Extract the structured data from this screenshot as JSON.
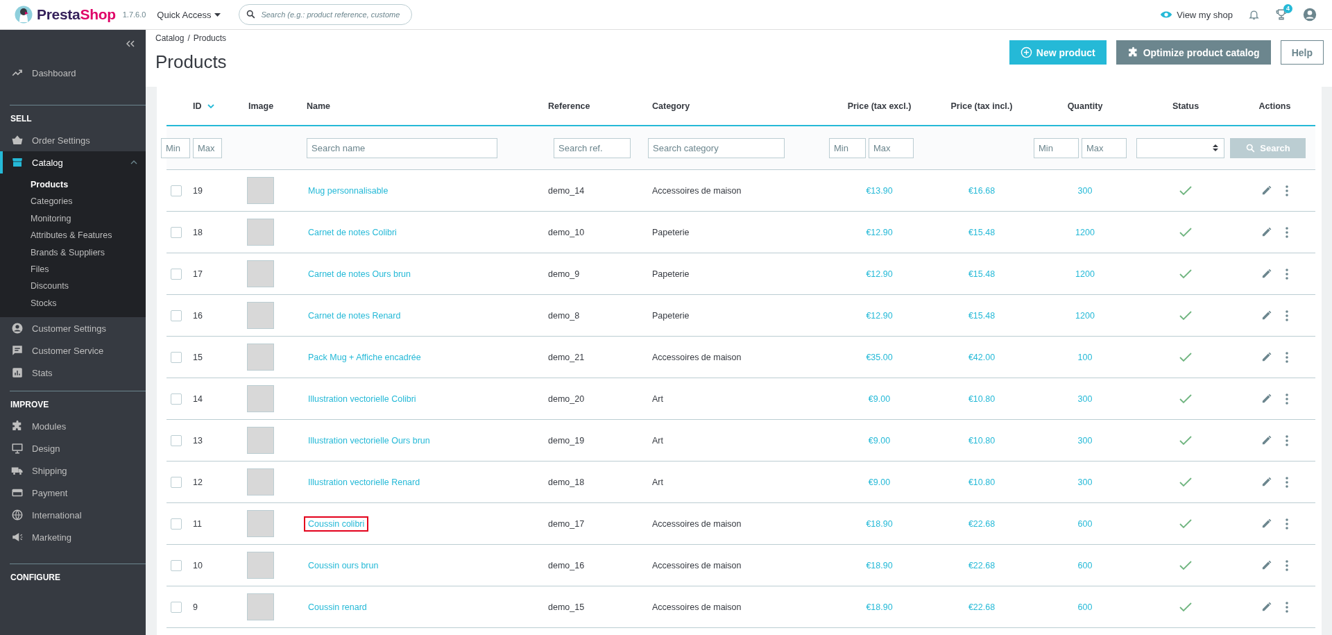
{
  "header": {
    "logo": {
      "first": "Presta",
      "second": "Shop"
    },
    "version": "1.7.6.0",
    "quick_access": "Quick Access",
    "search": {
      "placeholder": "Search (e.g.: product reference, custome"
    },
    "view_shop": "View my shop",
    "trophy_badge": "4"
  },
  "sidebar": {
    "sections": [
      {
        "items": [
          {
            "label": "Dashboard",
            "selected": false
          }
        ]
      },
      {
        "title": "SELL",
        "items": [
          {
            "label": "Order Settings",
            "selected": false
          },
          {
            "label": "Catalog",
            "selected": true,
            "expanded": true,
            "children": [
              {
                "label": "Products",
                "selected": true
              },
              {
                "label": "Categories",
                "selected": false
              },
              {
                "label": "Monitoring",
                "selected": false
              },
              {
                "label": "Attributes & Features",
                "selected": false
              },
              {
                "label": "Brands & Suppliers",
                "selected": false
              },
              {
                "label": "Files",
                "selected": false
              },
              {
                "label": "Discounts",
                "selected": false
              },
              {
                "label": "Stocks",
                "selected": false
              }
            ]
          },
          {
            "label": "Customer Settings",
            "selected": false
          },
          {
            "label": "Customer Service",
            "selected": false
          },
          {
            "label": "Stats",
            "selected": false
          }
        ]
      },
      {
        "title": "IMPROVE",
        "items": [
          {
            "label": "Modules",
            "selected": false
          },
          {
            "label": "Design",
            "selected": false
          },
          {
            "label": "Shipping",
            "selected": false
          },
          {
            "label": "Payment",
            "selected": false
          },
          {
            "label": "International",
            "selected": false
          },
          {
            "label": "Marketing",
            "selected": false
          }
        ]
      },
      {
        "title": "CONFIGURE"
      }
    ]
  },
  "breadcrumb": {
    "items": [
      "Catalog",
      "Products"
    ],
    "separator": "/"
  },
  "page_title": "Products",
  "actions": [
    {
      "label": "New product",
      "kind": "primary"
    },
    {
      "label": "Optimize product catalog",
      "kind": "secondary"
    },
    {
      "label": "Help",
      "kind": "outline"
    }
  ],
  "table": {
    "columns": [
      {
        "label": "ID",
        "sorted": true
      },
      {
        "label": "Image",
        "sorted": false
      },
      {
        "label": "Name",
        "sorted": false
      },
      {
        "label": "Reference",
        "sorted": false
      },
      {
        "label": "Category",
        "sorted": false
      },
      {
        "label": "Price (tax excl.)",
        "sorted": false
      },
      {
        "label": "Price (tax incl.)",
        "sorted": false
      },
      {
        "label": "Quantity",
        "sorted": false
      },
      {
        "label": "Status",
        "sorted": false
      },
      {
        "label": "Actions",
        "sorted": false
      }
    ],
    "filters": {
      "id_min": {
        "placeholder": "Min"
      },
      "id_max": {
        "placeholder": "Max"
      },
      "name": {
        "placeholder": "Search name"
      },
      "reference": {
        "placeholder": "Search ref."
      },
      "category": {
        "placeholder": "Search category"
      },
      "price_min": {
        "placeholder": "Min"
      },
      "price_max": {
        "placeholder": "Max"
      },
      "quantity_min": {
        "placeholder": "Min"
      },
      "quantity_max": {
        "placeholder": "Max"
      },
      "search_button": {
        "label": "Search",
        "disabled": true
      }
    },
    "rows": [
      {
        "id": "19",
        "name": "Mug personnalisable",
        "reference": "demo_14",
        "category": "Accessoires de maison",
        "price_excl": "€13.90",
        "price_incl": "€16.68",
        "quantity": "300",
        "active": true,
        "checked": false,
        "highlighted": false
      },
      {
        "id": "18",
        "name": "Carnet de notes Colibri",
        "reference": "demo_10",
        "category": "Papeterie",
        "price_excl": "€12.90",
        "price_incl": "€15.48",
        "quantity": "1200",
        "active": true,
        "checked": false,
        "highlighted": false
      },
      {
        "id": "17",
        "name": "Carnet de notes Ours brun",
        "reference": "demo_9",
        "category": "Papeterie",
        "price_excl": "€12.90",
        "price_incl": "€15.48",
        "quantity": "1200",
        "active": true,
        "checked": false,
        "highlighted": false
      },
      {
        "id": "16",
        "name": "Carnet de notes Renard",
        "reference": "demo_8",
        "category": "Papeterie",
        "price_excl": "€12.90",
        "price_incl": "€15.48",
        "quantity": "1200",
        "active": true,
        "checked": false,
        "highlighted": false
      },
      {
        "id": "15",
        "name": "Pack Mug + Affiche encadrée",
        "reference": "demo_21",
        "category": "Accessoires de maison",
        "price_excl": "€35.00",
        "price_incl": "€42.00",
        "quantity": "100",
        "active": true,
        "checked": false,
        "highlighted": false
      },
      {
        "id": "14",
        "name": "Illustration vectorielle Colibri",
        "reference": "demo_20",
        "category": "Art",
        "price_excl": "€9.00",
        "price_incl": "€10.80",
        "quantity": "300",
        "active": true,
        "checked": false,
        "highlighted": false
      },
      {
        "id": "13",
        "name": "Illustration vectorielle Ours brun",
        "reference": "demo_19",
        "category": "Art",
        "price_excl": "€9.00",
        "price_incl": "€10.80",
        "quantity": "300",
        "active": true,
        "checked": false,
        "highlighted": false
      },
      {
        "id": "12",
        "name": "Illustration vectorielle Renard",
        "reference": "demo_18",
        "category": "Art",
        "price_excl": "€9.00",
        "price_incl": "€10.80",
        "quantity": "300",
        "active": true,
        "checked": false,
        "highlighted": false
      },
      {
        "id": "11",
        "name": "Coussin colibri",
        "reference": "demo_17",
        "category": "Accessoires de maison",
        "price_excl": "€18.90",
        "price_incl": "€22.68",
        "quantity": "600",
        "active": true,
        "checked": false,
        "highlighted": true
      },
      {
        "id": "10",
        "name": "Coussin ours brun",
        "reference": "demo_16",
        "category": "Accessoires de maison",
        "price_excl": "€18.90",
        "price_incl": "€22.68",
        "quantity": "600",
        "active": true,
        "checked": false,
        "highlighted": false
      },
      {
        "id": "9",
        "name": "Coussin renard",
        "reference": "demo_15",
        "category": "Accessoires de maison",
        "price_excl": "€18.90",
        "price_incl": "€22.68",
        "quantity": "600",
        "active": true,
        "checked": false,
        "highlighted": false
      }
    ]
  }
}
